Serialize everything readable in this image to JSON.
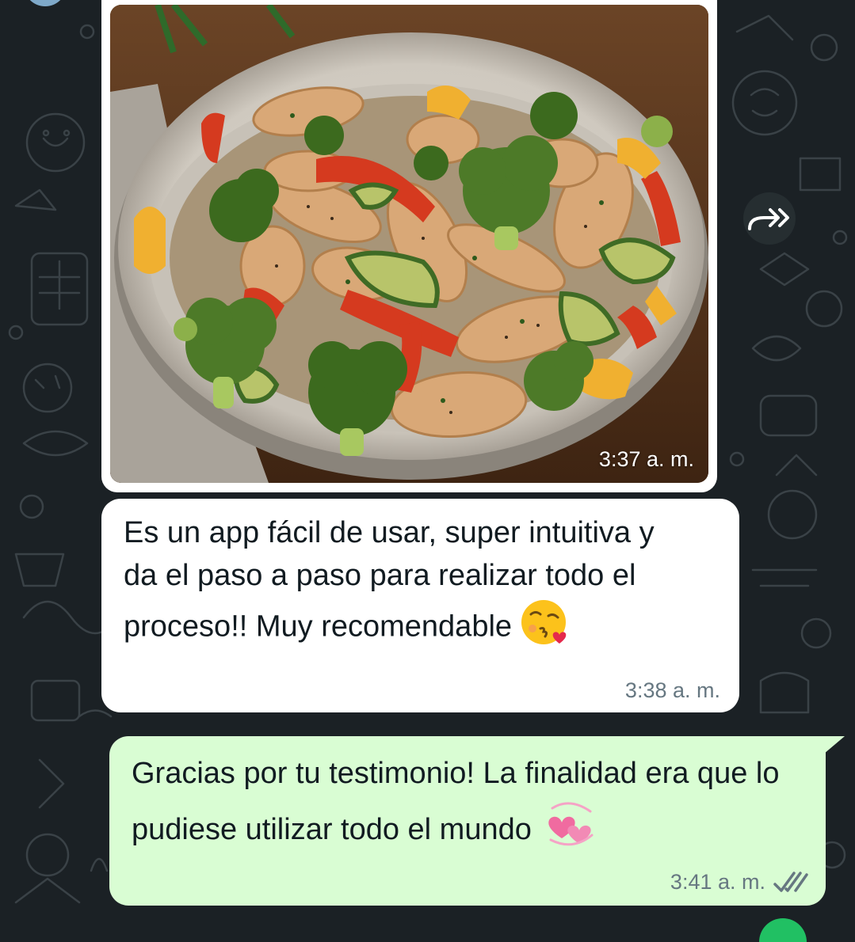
{
  "messages": {
    "image": {
      "time": "3:37 a. m."
    },
    "received": {
      "text": "Es un app fácil de usar, super intuitiva y da el paso a paso para realizar todo el proceso!! Muy recomendable",
      "time": "3:38 a. m.",
      "emoji": "kissing-face-with-heart-emoji"
    },
    "sent": {
      "text": "Gracias por tu testimonio! La finalidad era que lo pudiese utilizar todo el mundo",
      "time": "3:41 a. m.",
      "emoji": "revolving-hearts-emoji",
      "status": "read"
    }
  },
  "colors": {
    "background": "#1b2125",
    "received_bubble": "#ffffff",
    "sent_bubble": "#d9fdd3",
    "read_ticks": "#667781"
  },
  "icons": [
    "forward-icon",
    "double-check-icon"
  ]
}
